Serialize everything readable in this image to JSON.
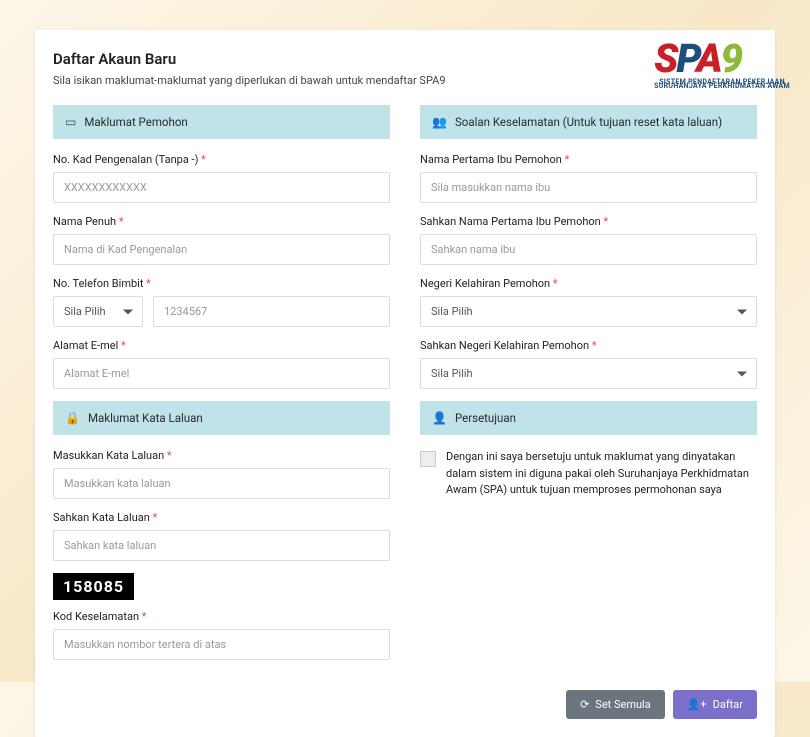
{
  "logo": {
    "line1": "SISTEM PENDAFTARAN PEKERJAAN",
    "line2": "SURUHANJAYA PERKHIDMATAN AWAM"
  },
  "page": {
    "title": "Daftar Akaun Baru",
    "subtitle": "Sila isikan maklumat-maklumat yang diperlukan di bawah untuk mendaftar SPA9"
  },
  "sections": {
    "applicant": "Maklumat Pemohon",
    "password": "Maklumat Kata Laluan",
    "security": "Soalan Keselamatan (Untuk tujuan reset kata laluan)",
    "consent": "Persetujuan"
  },
  "fields": {
    "ic": {
      "label": "No. Kad Pengenalan (Tanpa -)",
      "placeholder": "XXXXXXXXXXXX"
    },
    "fullname": {
      "label": "Nama Penuh",
      "placeholder": "Nama di Kad Pengenalan"
    },
    "phone": {
      "label": "No. Telefon Bimbit",
      "prefix_placeholder": "Sila Pilih",
      "placeholder": "1234567"
    },
    "email": {
      "label": "Alamat E-mel",
      "placeholder": "Alamat E-mel"
    },
    "pwd": {
      "label": "Masukkan Kata Laluan",
      "placeholder": "Masukkan kata laluan"
    },
    "pwd2": {
      "label": "Sahkan Kata Laluan",
      "placeholder": "Sahkan kata laluan"
    },
    "captcha_value": "158085",
    "captcha": {
      "label": "Kod Keselamatan",
      "placeholder": "Masukkan nombor tertera di atas"
    },
    "mother": {
      "label": "Nama Pertama Ibu Pemohon",
      "placeholder": "Sila masukkan nama ibu"
    },
    "mother2": {
      "label": "Sahkan Nama Pertama Ibu Pemohon",
      "placeholder": "Sahkan nama ibu"
    },
    "state": {
      "label": "Negeri Kelahiran Pemohon",
      "placeholder": "Sila Pilih"
    },
    "state2": {
      "label": "Sahkan Negeri Kelahiran Pemohon",
      "placeholder": "Sila Pilih"
    }
  },
  "consent_text": "Dengan ini saya bersetuju untuk maklumat yang dinyatakan dalam sistem ini diguna pakai oleh Suruhanjaya Perkhidmatan Awam (SPA) untuk tujuan memproses permohonan saya",
  "buttons": {
    "reset": "Set Semula",
    "register": "Daftar"
  }
}
